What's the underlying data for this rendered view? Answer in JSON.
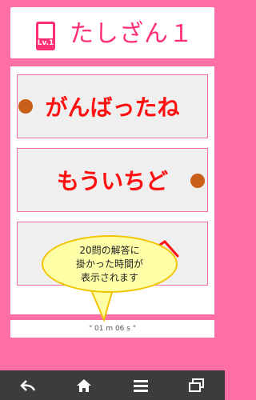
{
  "header": {
    "title": "たしざん１",
    "level_badge": "Lv.1"
  },
  "buttons": [
    {
      "label": "がんばったね"
    },
    {
      "label": "もういちど"
    },
    {
      "label": ""
    }
  ],
  "callout": {
    "lines": [
      "20問の解答に",
      "掛かった時間が",
      "表示されます"
    ]
  },
  "time_display": "\" 01 m 06 s \"",
  "colors": {
    "background": "#ff6fa5",
    "accent": "#ff2f73",
    "button_text": "#ff1010",
    "marker": "#c8601a"
  },
  "icons": {
    "nav": [
      "back-icon",
      "home-icon",
      "menu-icon",
      "recent-apps-icon"
    ]
  }
}
